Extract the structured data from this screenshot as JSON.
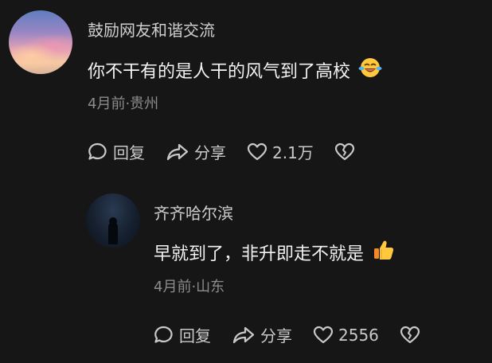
{
  "comment": {
    "username": "鼓励网友和谐交流",
    "text": "你不干有的是人干的风气到了高校",
    "emoji": "laughing-crying-emoji",
    "meta": "4月前·贵州",
    "reply_label": "回复",
    "share_label": "分享",
    "like_count": "2.1万"
  },
  "reply": {
    "username": "齐齐哈尔滨",
    "text": "早就到了，非升即走不就是",
    "emoji": "thumbs-up-emoji",
    "meta": "4月前·山东",
    "reply_label": "回复",
    "share_label": "分享",
    "like_count": "2556"
  }
}
